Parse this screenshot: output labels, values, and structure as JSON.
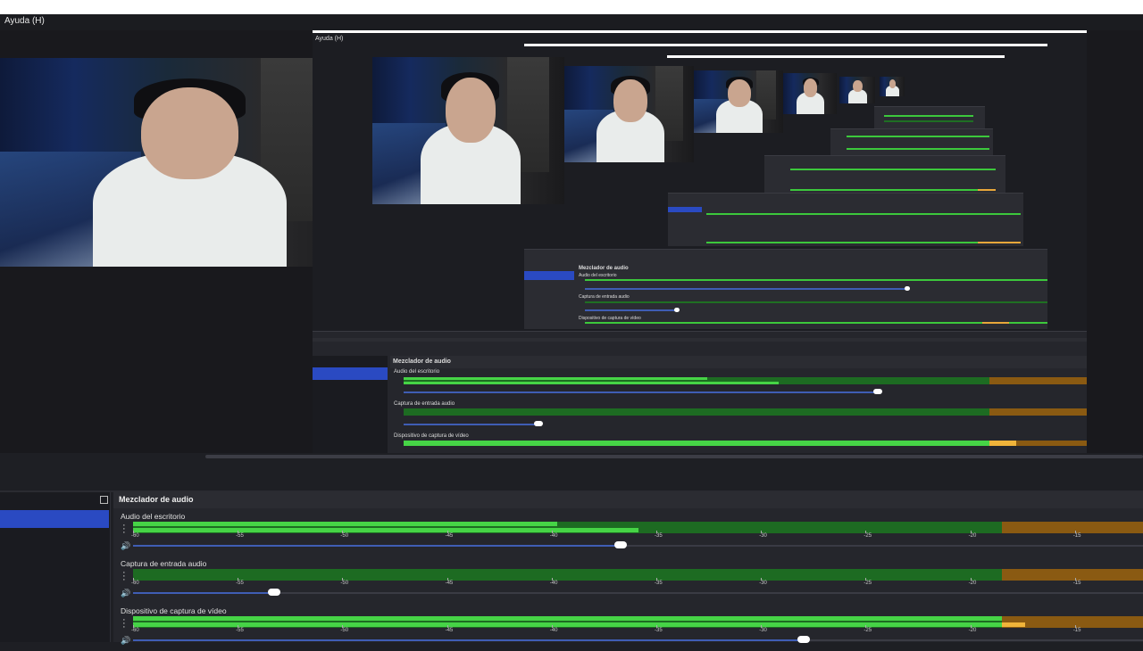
{
  "window": {
    "menu_help": "Ayuda (H)"
  },
  "nested": {
    "menu_help_small": "Ayuda (H)",
    "mixer_title_small": "Mezclador de audio",
    "track_names_small": [
      "Audio del escritorio",
      "Captura de entrada audio",
      "Dispositivo de captura de vídeo"
    ]
  },
  "mixer": {
    "title": "Mezclador de audio",
    "tick_labels": [
      "-60",
      "-55",
      "-50",
      "-45",
      "-40",
      "-35",
      "-30",
      "-25",
      "-20",
      "-15"
    ],
    "tracks": [
      {
        "name": "Audio del escritorio",
        "level_top": 0.42,
        "level_bottom": 0.5,
        "volume": 0.69
      },
      {
        "name": "Captura de entrada audio",
        "level_top": 0.0,
        "level_bottom": 0.0,
        "volume": 0.2
      },
      {
        "name": "Dispositivo de captura de vídeo",
        "level_top": 0.86,
        "level_bottom": 0.86,
        "volume": 0.95
      }
    ]
  },
  "colors": {
    "meter_green": "#46d446",
    "meter_dark_green": "#1d6b22",
    "meter_orange": "#f0b43a",
    "slider_fill": "#3f5db4",
    "scene_selected": "#2a4ac2"
  }
}
